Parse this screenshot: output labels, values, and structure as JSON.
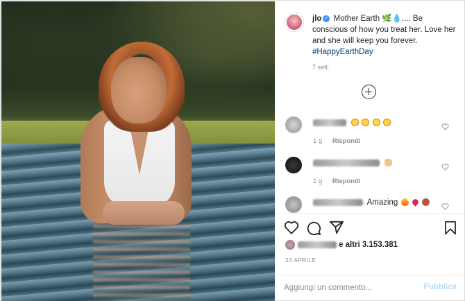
{
  "post": {
    "username": "jlo",
    "caption": "Mother Earth 🌿💧.... Be conscious of how you treat her. Love her and she will keep you forever.",
    "hashtag": "#HappyEarthDay",
    "caption_time": "7 sett."
  },
  "comments": [
    {
      "text_suffix": "",
      "time": "1 g",
      "reply": "Rispondi",
      "emojis": [
        "star-eyes",
        "star-eyes",
        "star-eyes",
        "star-eyes"
      ]
    },
    {
      "text_suffix": "",
      "time": "1 g",
      "reply": "Rispondi",
      "emojis": [
        "hand"
      ]
    },
    {
      "text_suffix": "Amazing",
      "time": "",
      "reply": "",
      "emojis": [
        "fire",
        "heart",
        "rose"
      ]
    }
  ],
  "likes": {
    "text": "e altri 3.153.381"
  },
  "date": "23 APRILE",
  "comment_form": {
    "placeholder": "Aggiungi un commento...",
    "publish_label": "Pubblica"
  },
  "colors": {
    "link": "#00376b",
    "verified": "#3897f0",
    "publish_disabled": "#b2dffc"
  }
}
